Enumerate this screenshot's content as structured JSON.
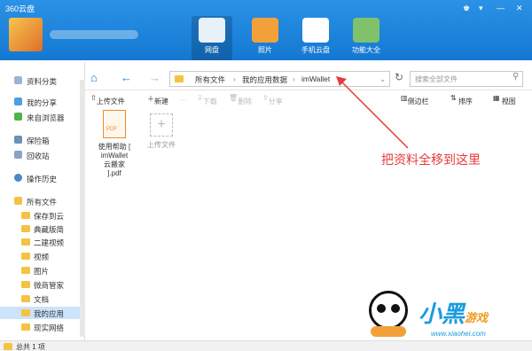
{
  "app": {
    "title": "360云盘"
  },
  "window_controls": [
    "♚",
    "▾",
    "—",
    "✕"
  ],
  "top_nav": [
    {
      "label": "网盘",
      "icon": "cloud-icon",
      "active": true
    },
    {
      "label": "照片",
      "icon": "photo-icon",
      "active": false
    },
    {
      "label": "手机云盘",
      "icon": "phone-cloud-icon",
      "active": false
    },
    {
      "label": "功能大全",
      "icon": "toolbox-icon",
      "active": false
    }
  ],
  "breadcrumb": [
    "所有文件",
    "我的应用数据",
    "imWallet"
  ],
  "search": {
    "placeholder": "搜索全部文件"
  },
  "actions": {
    "upload": "上传文件",
    "new": "新建",
    "download": "下载",
    "delete": "删除",
    "share": "分享"
  },
  "view_options": {
    "sidebar": "侧边栏",
    "sort": "排序",
    "view": "视图"
  },
  "sidebar": {
    "top": [
      {
        "label": "资料分类",
        "icon": "category-icon"
      },
      {
        "label": "我的分享",
        "icon": "share-icon"
      },
      {
        "label": "来自浏览器",
        "icon": "browser-icon"
      },
      {
        "label": "保险箱",
        "icon": "safe-icon"
      },
      {
        "label": "回收站",
        "icon": "recycle-icon"
      },
      {
        "label": "操作历史",
        "icon": "history-icon"
      },
      {
        "label": "所有文件",
        "icon": "folder-icon"
      }
    ],
    "folders": [
      "保存到云",
      "典藏版简",
      "二建视频",
      "视频",
      "图片",
      "微商管家",
      "文档",
      "我的应用",
      "现实网络"
    ]
  },
  "files": [
    {
      "name_lines": [
        "使用帮助 [",
        "imWallet",
        "云搬家",
        "].pdf"
      ],
      "icon": "pdf-icon"
    },
    {
      "name_lines": [
        "上传文件"
      ],
      "icon": "upload-plus-icon"
    }
  ],
  "annotation": "把资料全移到这里",
  "status": {
    "count": "总共 1 项"
  },
  "watermark": {
    "site": "www.xiaohei.com"
  },
  "colors": {
    "header": "#1d85dd",
    "accent": "#e63b3b"
  }
}
